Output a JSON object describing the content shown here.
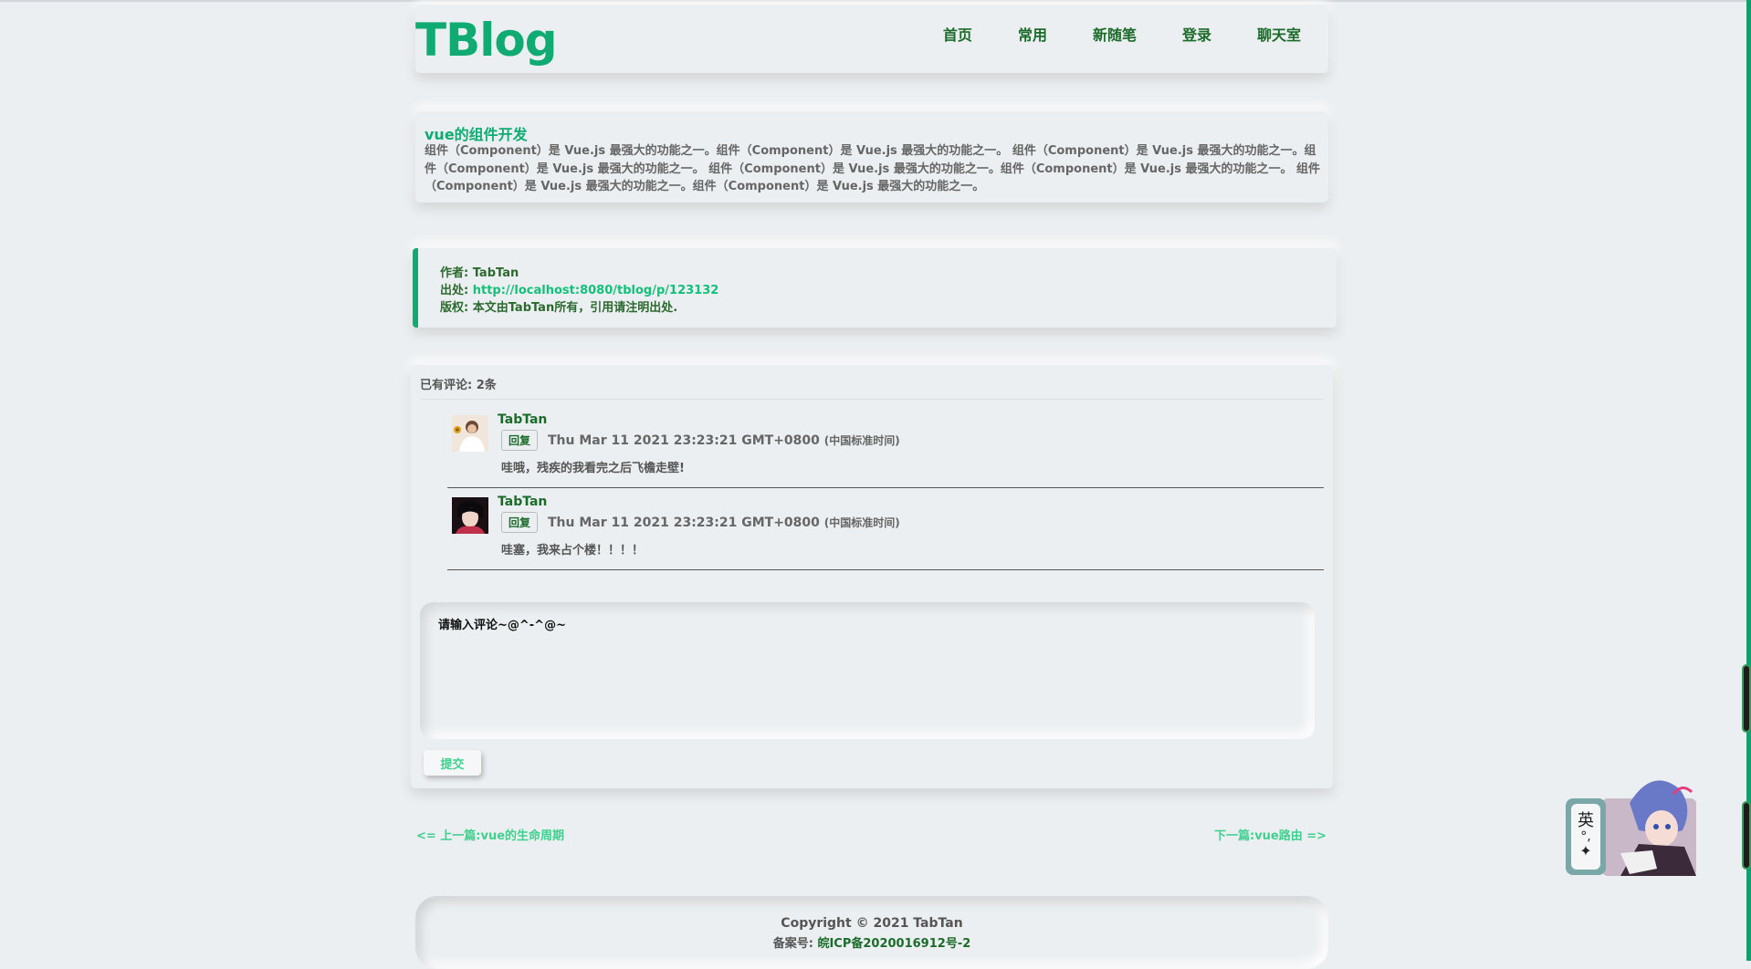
{
  "header": {
    "logo": "TBlog",
    "nav": [
      "首页",
      "常用",
      "新随笔",
      "登录",
      "聊天室"
    ]
  },
  "article": {
    "title": "vue的组件开发",
    "body": "组件（Component）是 Vue.js 最强大的功能之一。组件（Component）是 Vue.js 最强大的功能之一。 组件（Component）是 Vue.js 最强大的功能之一。组件（Component）是 Vue.js 最强大的功能之一。 组件（Component）是 Vue.js 最强大的功能之一。组件（Component）是 Vue.js 最强大的功能之一。 组件（Component）是 Vue.js 最强大的功能之一。组件（Component）是 Vue.js 最强大的功能之一。"
  },
  "copyright_info": {
    "author_label": "作者: ",
    "author": "TabTan",
    "source_label": "出处: ",
    "source_url": "http://localhost:8080/tblog/p/123132",
    "rights": "版权: 本文由TabTan所有，引用请注明出处."
  },
  "comments": {
    "count_text": "已有评论: 2条",
    "items": [
      {
        "user": "TabTan",
        "reply_label": "回复",
        "time": "Thu Mar 11 2021 23:23:21 GMT+0800",
        "timezone": "(中国标准时间)",
        "text": "哇哦，残疾的我看完之后飞檐走壁!"
      },
      {
        "user": "TabTan",
        "reply_label": "回复",
        "time": "Thu Mar 11 2021 23:23:21 GMT+0800",
        "timezone": "(中国标准时间)",
        "text": "哇塞，我来占个楼！！！！"
      }
    ],
    "input_placeholder": "请输入评论~@^-^@~",
    "submit_label": "提交"
  },
  "pager": {
    "prev": "<= 上一篇:vue的生命周期",
    "next": "下一篇:vue路由 =>"
  },
  "footer": {
    "copyright": "Copyright © 2021 TabTan",
    "icp_label": "备案号: ",
    "icp": "皖ICP备2020016912号-2"
  },
  "widget": {
    "ime_label": "英"
  },
  "colors": {
    "accent": "#10ab72",
    "nav_text": "#1b6b2a",
    "background": "#eceff1"
  }
}
